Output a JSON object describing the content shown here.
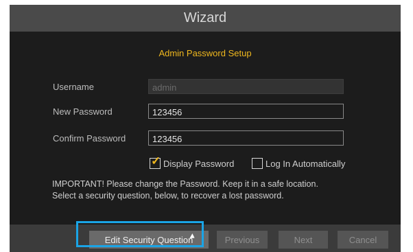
{
  "window": {
    "title": "Wizard"
  },
  "section": {
    "title": "Admin Password Setup"
  },
  "form": {
    "username": {
      "label": "Username",
      "value": "admin",
      "enabled": false
    },
    "new_password": {
      "label": "New Password",
      "value": "123456"
    },
    "confirm_password": {
      "label": "Confirm Password",
      "value": "123456"
    }
  },
  "options": {
    "display_password": {
      "label": "Display Password",
      "checked": true
    },
    "log_in_automatically": {
      "label": "Log In Automatically",
      "checked": false
    }
  },
  "note": "IMPORTANT! Please change the Password. Keep it in a safe location. Select a security question, below, to recover a lost password.",
  "buttons": {
    "edit_security_question": "Edit Security Question",
    "previous": "Previous",
    "next": "Next",
    "cancel": "Cancel"
  },
  "colors": {
    "accent": "#f0b81e",
    "highlight": "#1aa4e6",
    "dialog_bg": "#1c1c1c",
    "title_bar": "#4a4a4a"
  },
  "icons": {
    "check": "check-icon",
    "cursor": "mouse-cursor-icon"
  }
}
